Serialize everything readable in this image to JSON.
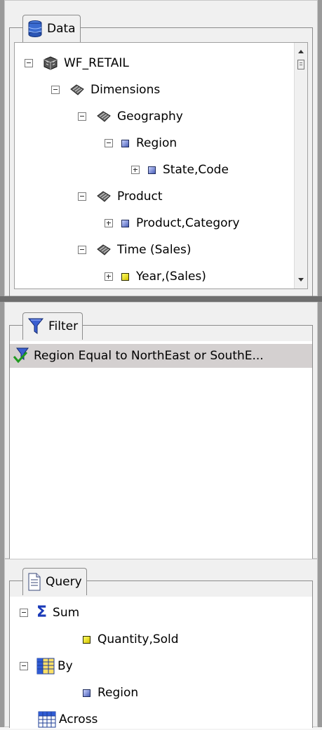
{
  "data_panel": {
    "title": "Data",
    "tree": [
      {
        "label": "WF_RETAIL"
      },
      {
        "label": "Dimensions"
      },
      {
        "label": "Geography"
      },
      {
        "label": "Region"
      },
      {
        "label": "State,Code"
      },
      {
        "label": "Product"
      },
      {
        "label": "Product,Category"
      },
      {
        "label": "Time (Sales)"
      },
      {
        "label": "Year,(Sales)"
      }
    ]
  },
  "filter_panel": {
    "title": "Filter",
    "items": [
      {
        "label": "Region Equal to NorthEast or SouthE..."
      }
    ]
  },
  "query_panel": {
    "title": "Query",
    "tree": [
      {
        "label": "Sum"
      },
      {
        "label": "Quantity,Sold"
      },
      {
        "label": "By"
      },
      {
        "label": "Region"
      },
      {
        "label": "Across"
      }
    ]
  }
}
